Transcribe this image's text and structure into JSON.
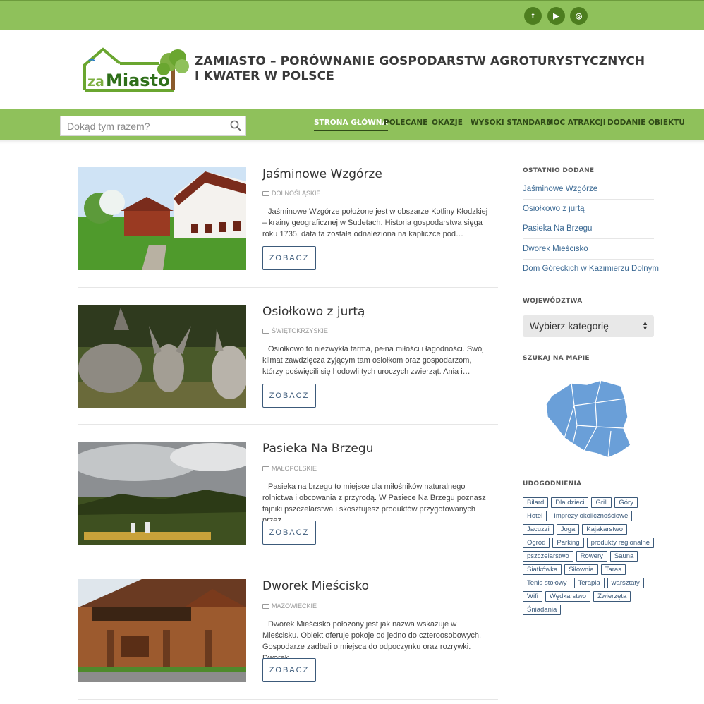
{
  "social": {
    "facebook_label": "f",
    "youtube_label": "▶",
    "instagram_label": "◎"
  },
  "header": {
    "logo_text_za": "za",
    "logo_text_miasto": "Miasto",
    "site_title": "ZAMIASTO – PORÓWNANIE GOSPODARSTW AGROTURYSTYCZNYCH I KWATER W POLSCE"
  },
  "search": {
    "placeholder": "Dokąd tym razem?",
    "value": ""
  },
  "nav": {
    "items": [
      "STRONA GŁÓWNA",
      "POLECANE",
      "OKAZJE",
      "WYSOKI STANDARD",
      "MOC ATRAKCJI",
      "DODANIE OBIEKTU"
    ],
    "active": "STRONA GŁÓWNA"
  },
  "posts": [
    {
      "title": "Jaśminowe Wzgórze",
      "category": "DOLNOŚLĄSKIE",
      "excerpt": "Jaśminowe Wzgórze położone jest w obszarze Kotliny Kłodzkiej – krainy geograficznej w Sudetach. Historia gospodarstwa sięga roku 1735, data ta została odnaleziona na kapliczce pod…",
      "button": "ZOBACZ"
    },
    {
      "title": "Osiołkowo z jurtą",
      "category": "ŚWIĘTOKRZYSKIE",
      "excerpt": "Osiołkowo to niezwykła farma, pełna miłości i łagodności. Swój klimat zawdzięcza żyjącym tam osiołkom oraz gospodarzom, którzy poświęcili się hodowli tych uroczych zwierząt. Ania i…",
      "button": "ZOBACZ"
    },
    {
      "title": "Pasieka Na Brzegu",
      "category": "MAŁOPOLSKIE",
      "excerpt": "Pasieka na brzegu to miejsce dla miłośników naturalnego rolnictwa i obcowania z przyrodą. W Pasiece Na Brzegu poznasz tajniki pszczelarstwa i skosztujesz produktów przygotowanych przez…",
      "button": "ZOBACZ"
    },
    {
      "title": "Dworek Mieścisko",
      "category": "MAZOWIECKIE",
      "excerpt": "Dworek Mieścisko położony jest jak nazwa wskazuje w Mieścisku. Obiekt oferuje pokoje od jedno do czteroosobowych. Gospodarze zadbali o miejsca do odpoczynku oraz rozrywki. Dworek…",
      "button": "ZOBACZ"
    }
  ],
  "sidebar": {
    "recent_heading": "OSTATNIO DODANE",
    "recent": [
      "Jaśminowe Wzgórze",
      "Osiołkowo z jurtą",
      "Pasieka Na Brzegu",
      "Dworek Mieścisko",
      "Dom Góreckich w Kazimierzu Dolnym"
    ],
    "voivodeship_heading": "WOJEWÓDZTWA",
    "select_value": "Wybierz kategorię",
    "map_heading": "SZUKAJ NA MAPIE",
    "tags_heading": "UDOGODNIENIA",
    "tags": [
      "Bilard",
      "Dla dzieci",
      "Grill",
      "Góry",
      "Hotel",
      "Imprezy okolicznościowe",
      "Jacuzzi",
      "Joga",
      "Kajakarstwo",
      "Ogród",
      "Parking",
      "produkty regionalne",
      "pszczelarstwo",
      "Rowery",
      "Sauna",
      "Siatkówka",
      "Siłownia",
      "Taras",
      "Tenis stołowy",
      "Terapia",
      "warsztaty",
      "Wifi",
      "Wędkarstwo",
      "Zwierzęta",
      "Śniadania"
    ]
  },
  "colors": {
    "green_bar": "#8fc15b",
    "social_bg": "#4d7e1f",
    "nav_text": "#2f4a17",
    "link_blue": "#3c6a94",
    "button_border": "#3c5a7a",
    "map_fill": "#6a9fd8"
  }
}
